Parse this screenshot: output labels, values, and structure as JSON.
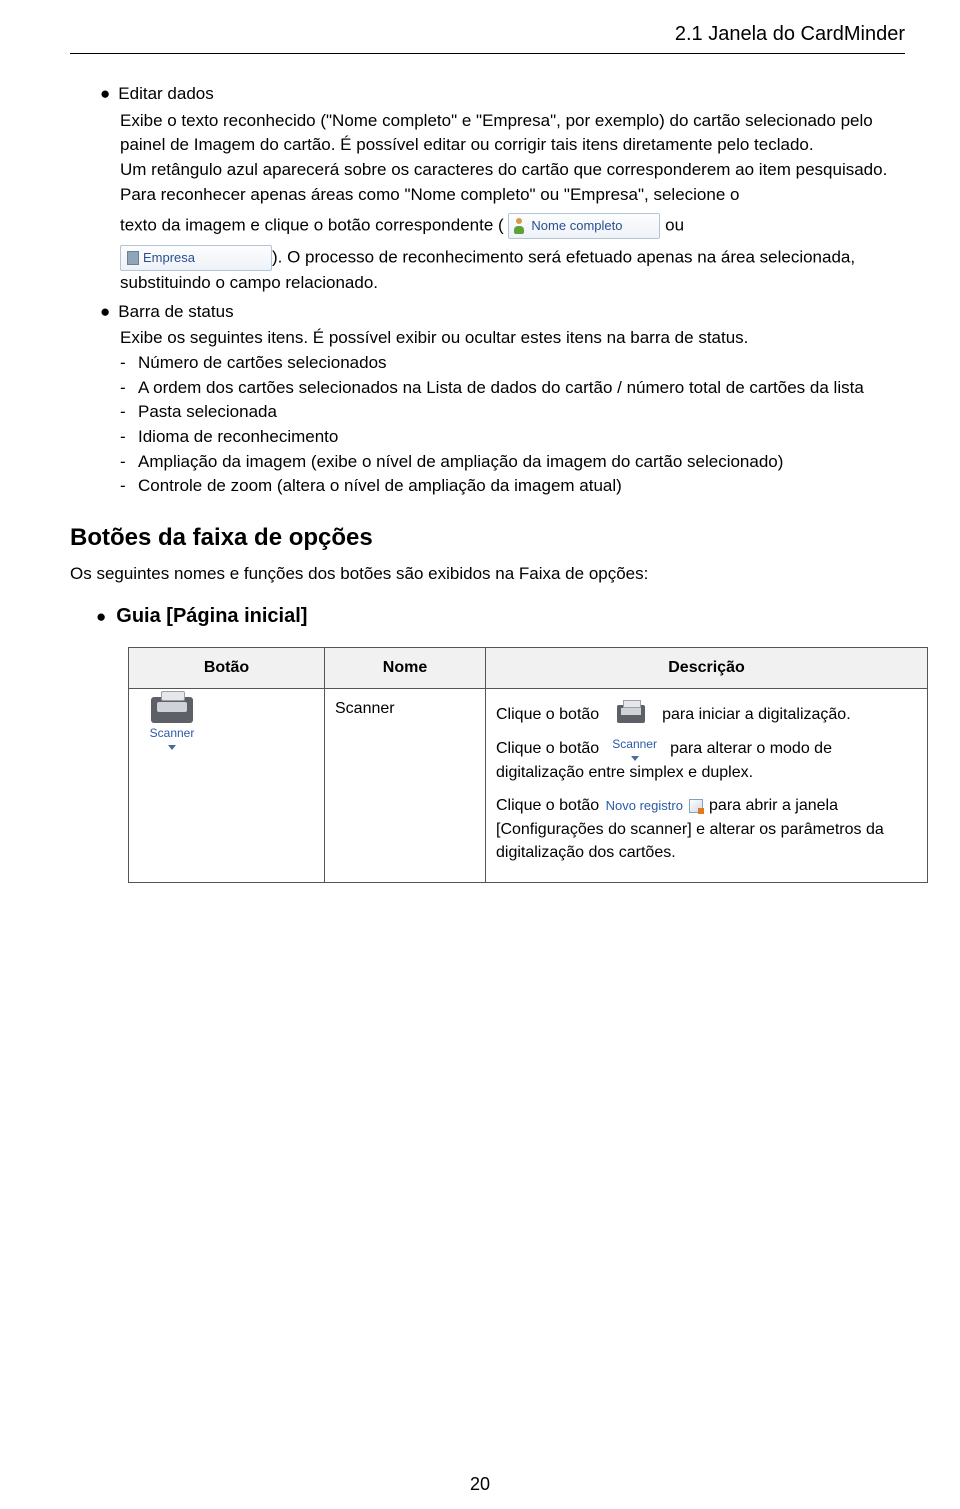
{
  "header": {
    "title": "2.1  Janela do CardMinder"
  },
  "editar": {
    "heading": "Editar dados",
    "p1": "Exibe o texto reconhecido (\"Nome completo\" e \"Empresa\", por exemplo) do cartão selecionado pelo painel de Imagem do cartão. É possível editar ou corrigir tais itens diretamente pelo teclado.",
    "p2": "Um retângulo azul aparecerá sobre os caracteres do cartão que corresponderem ao item pesquisado.",
    "p3a": "Para reconhecer apenas áreas como \"Nome completo\" ou \"Empresa\", selecione o",
    "p3b": "texto da imagem e clique o botão correspondente (",
    "btn_nome": "Nome completo",
    "p3c": " ou",
    "btn_empresa": "Empresa",
    "p3d": "). O processo de reconhecimento será efetuado apenas na área selecionada, substituindo o campo relacionado."
  },
  "status": {
    "heading": "Barra de status",
    "intro": "Exibe os seguintes itens. É possível exibir ou ocultar estes itens na barra de status.",
    "items": [
      "Número de cartões selecionados",
      "A ordem dos cartões selecionados na Lista de dados do cartão / número total de cartões da lista",
      "Pasta selecionada",
      "Idioma de reconhecimento",
      "Ampliação da imagem (exibe o nível de ampliação da imagem do cartão selecionado)",
      "Controle de zoom (altera o nível de ampliação da imagem atual)"
    ]
  },
  "ribbon": {
    "heading": "Botões da faixa de opções",
    "intro": "Os seguintes nomes e funções dos botões são exibidos na Faixa de opções:",
    "tab": "Guia [Página inicial]"
  },
  "table": {
    "head": {
      "botao": "Botão",
      "nome": "Nome",
      "desc": "Descrição"
    },
    "row1": {
      "nome": "Scanner",
      "scanner_label": "Scanner",
      "d1a": "Clique o botão ",
      "d1b": " para iniciar a digitalização.",
      "d2a": "Clique o botão ",
      "d2b": " para alterar o modo de digitalização entre simplex e duplex.",
      "d3a": "Clique o botão ",
      "novo": "Novo registro",
      "d3b": " para abrir a janela [Configurações do scanner] e alterar os parâmetros da digitalização dos cartões."
    }
  },
  "pagenum": "20"
}
